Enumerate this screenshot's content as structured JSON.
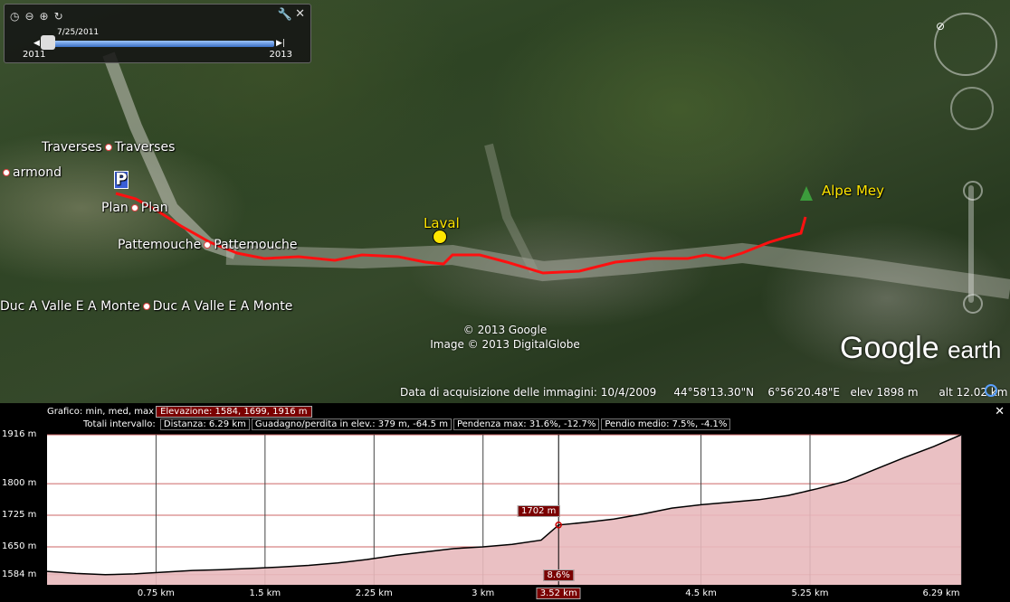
{
  "timebar": {
    "icons": [
      "clock-icon",
      "zoom-out-icon",
      "zoom-in-icon",
      "refresh-icon"
    ],
    "date": "7/25/2011",
    "start_year": "2011",
    "end_year": "2013"
  },
  "places": [
    {
      "name": "Traverses",
      "label2": "Traverses"
    },
    {
      "name": "armond"
    },
    {
      "name": "Plan",
      "label2": "Plan"
    },
    {
      "name": "Pattemouche",
      "label2": "Pattemouche"
    },
    {
      "name": "Duc A Valle E A Monte",
      "label2": "Duc A Valle E A Monte"
    }
  ],
  "markers": {
    "laval": "Laval",
    "alpe_mey": "Alpe Mey",
    "parking": "P"
  },
  "copyright": [
    "© 2013 Google",
    "Image © 2013 DigitalGlobe"
  ],
  "logo": {
    "google": "Google",
    "earth": "earth"
  },
  "status": {
    "acquisition": "Data di acquisizione delle immagini: 10/4/2009",
    "lat": "44°58'13.30\"N",
    "lon": "6°56'20.48\"E",
    "elev": "elev  1898 m",
    "alt": "alt  12.02 km"
  },
  "profile_panel": {
    "graph_label": "Grafico: min, med, max",
    "elevation": "Elevazione: 1584, 1699, 1916 m",
    "totals_label": "Totali intervallo:",
    "distance": "Distanza: 6.29 km",
    "gain": "Guadagno/perdita in elev.: 379 m, -64.5 m",
    "slope_max": "Pendenza max: 31.6%, -12.7%",
    "slope_avg": "Pendio medio: 7.5%, -4.1%",
    "cursor_elev": "1702 m",
    "cursor_slope": "8.6%",
    "cursor_dist": "3.52 km"
  },
  "chart_data": {
    "type": "area",
    "title": "",
    "xlabel": "",
    "ylabel": "",
    "ylim": [
      1560,
      1916
    ],
    "xlim": [
      0,
      6.29
    ],
    "y_ticks": [
      "1916 m",
      "1800 m",
      "1725 m",
      "1650 m",
      "1584 m"
    ],
    "y_tick_values": [
      1916,
      1800,
      1725,
      1650,
      1584
    ],
    "x_ticks": [
      "0.75 km",
      "1.5 km",
      "2.25 km",
      "3 km",
      "3.52 km",
      "4.5 km",
      "5.25 km",
      "6.29 km"
    ],
    "x_tick_values": [
      0.75,
      1.5,
      2.25,
      3,
      3.52,
      4.5,
      5.25,
      6.29
    ],
    "series": [
      {
        "x": [
          0,
          0.2,
          0.4,
          0.6,
          0.8,
          1.0,
          1.2,
          1.4,
          1.6,
          1.8,
          2.0,
          2.2,
          2.4,
          2.6,
          2.8,
          3.0,
          3.2,
          3.4,
          3.52,
          3.7,
          3.9,
          4.1,
          4.3,
          4.5,
          4.7,
          4.9,
          5.1,
          5.3,
          5.5,
          5.7,
          5.9,
          6.1,
          6.29
        ],
        "y": [
          1592,
          1587,
          1584,
          1586,
          1590,
          1594,
          1596,
          1599,
          1602,
          1606,
          1612,
          1620,
          1630,
          1638,
          1646,
          1650,
          1656,
          1666,
          1702,
          1708,
          1716,
          1728,
          1742,
          1750,
          1756,
          1762,
          1772,
          1788,
          1806,
          1834,
          1862,
          1888,
          1916
        ]
      }
    ],
    "cursor": {
      "x": 3.52,
      "y": 1702
    },
    "grid": true,
    "fill_color": "#e8b9bd",
    "line_color": "#000000"
  }
}
